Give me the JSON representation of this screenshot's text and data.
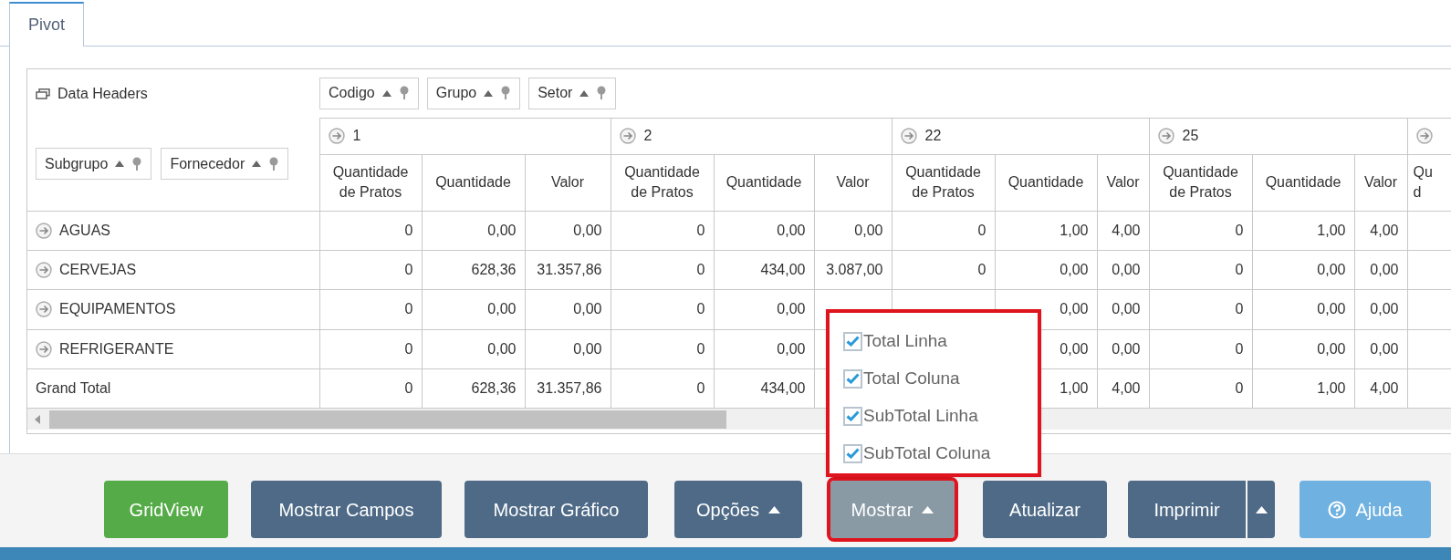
{
  "tabs": [
    {
      "label": "Pivot",
      "selected": true
    }
  ],
  "pivot": {
    "data_headers_label": "Data Headers",
    "column_fields": [
      "Codigo",
      "Grupo",
      "Setor"
    ],
    "row_fields": [
      "Subgrupo",
      "Fornecedor"
    ],
    "column_groups": [
      {
        "label": "1",
        "columns": [
          "Quantidade de Pratos",
          "Quantidade",
          "Valor"
        ]
      },
      {
        "label": "2",
        "columns": [
          "Quantidade de Pratos",
          "Quantidade",
          "Valor"
        ]
      },
      {
        "label": "22",
        "columns": [
          "Quantidade de Pratos",
          "Quantidade",
          "Valor"
        ]
      },
      {
        "label": "25",
        "columns": [
          "Quantidade de Pratos",
          "Quantidade",
          "Valor"
        ]
      },
      {
        "columns": [
          "Qu\nd"
        ]
      }
    ],
    "rows": [
      {
        "label": "AGUAS",
        "expandable": true,
        "cells": [
          "0",
          "0,00",
          "0,00",
          "0",
          "0,00",
          "0,00",
          "0",
          "1,00",
          "4,00",
          "0",
          "1,00",
          "4,00"
        ]
      },
      {
        "label": "CERVEJAS",
        "expandable": true,
        "cells": [
          "0",
          "628,36",
          "31.357,86",
          "0",
          "434,00",
          "3.087,00",
          "0",
          "0,00",
          "0,00",
          "0",
          "0,00",
          "0,00"
        ]
      },
      {
        "label": "EQUIPAMENTOS",
        "expandable": true,
        "cells": [
          "0",
          "0,00",
          "0,00",
          "0",
          "0,00",
          null,
          null,
          "0,00",
          "0,00",
          "0",
          "0,00",
          "0,00"
        ]
      },
      {
        "label": "REFRIGERANTE",
        "expandable": true,
        "cells": [
          "0",
          "0,00",
          "0,00",
          "0",
          "0,00",
          null,
          null,
          "0,00",
          "0,00",
          "0",
          "0,00",
          "0,00"
        ]
      },
      {
        "label": "Grand Total",
        "expandable": false,
        "cells": [
          "0",
          "628,36",
          "31.357,86",
          "0",
          "434,00",
          null,
          null,
          "1,00",
          "4,00",
          "0",
          "1,00",
          "4,00"
        ]
      }
    ]
  },
  "mostrar_menu": [
    {
      "label": "Total Linha",
      "checked": true
    },
    {
      "label": "Total Coluna",
      "checked": true
    },
    {
      "label": "SubTotal Linha",
      "checked": true
    },
    {
      "label": "SubTotal Coluna",
      "checked": true
    }
  ],
  "buttons": [
    {
      "label": "GridView",
      "kind": "main"
    },
    {
      "label": "Mostrar Campos",
      "kind": "plain"
    },
    {
      "label": "Mostrar Gráfico",
      "kind": "plain"
    },
    {
      "label": "Opções",
      "kind": "dropdown"
    },
    {
      "label": "Mostrar",
      "kind": "open-dropdown"
    },
    {
      "label": "Atualizar",
      "kind": "plain"
    },
    {
      "label": "Imprimir",
      "kind": "split"
    },
    {
      "label": "Ajuda",
      "kind": "help"
    }
  ]
}
